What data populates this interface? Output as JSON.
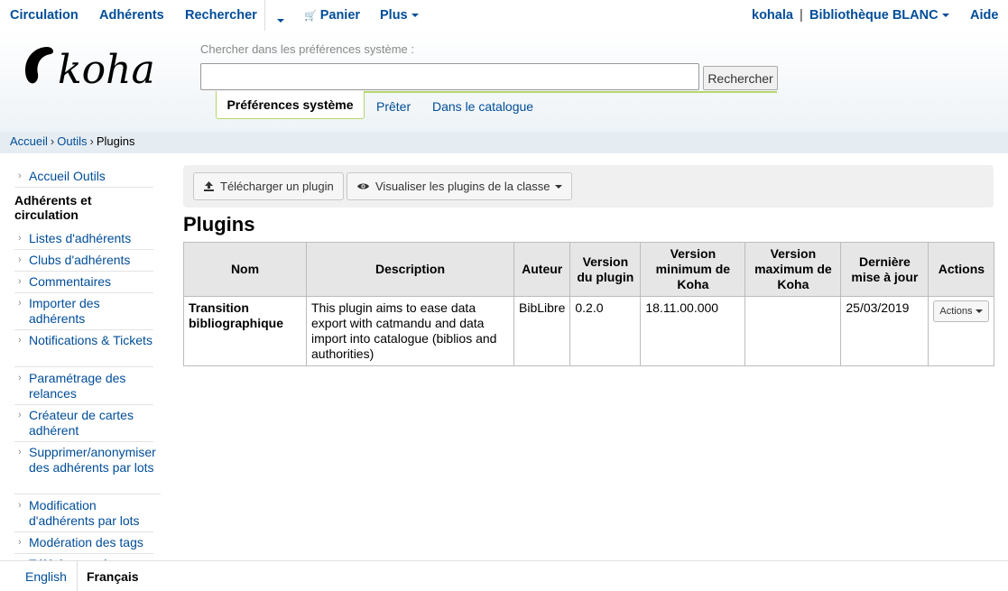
{
  "topnav": {
    "circulation": "Circulation",
    "patrons": "Adhérents",
    "search": "Rechercher",
    "cart": "Panier",
    "more": "Plus",
    "user": "kohala",
    "separator": "|",
    "library": "Bibliothèque BLANC",
    "help": "Aide"
  },
  "header": {
    "logo_text": "koha",
    "search_label": "Chercher dans les préférences système :",
    "search_value": "",
    "search_button": "Rechercher",
    "tabs": [
      {
        "label": "Préférences système",
        "active": true
      },
      {
        "label": "Prêter",
        "active": false
      },
      {
        "label": "Dans le catalogue",
        "active": false
      }
    ]
  },
  "breadcrumb": {
    "home": "Accueil",
    "tools": "Outils",
    "current": "Plugins",
    "separator": "›"
  },
  "sidebar": {
    "tools_home": "Accueil Outils",
    "section_heading": "Adhérents et circulation",
    "items": [
      "Listes d'adhérents",
      "Clubs d'adhérents",
      "Commentaires",
      "Importer des adhérents",
      "Notifications & Tickets",
      "Paramétrage des relances",
      "Créateur de cartes adhérent",
      "Supprimer/anonymiser des adhérents par lots",
      "Modification d'adhérents par lots",
      "Modération des tags",
      "Télécharger des..."
    ]
  },
  "toolbar": {
    "upload_label": "Télécharger un plugin",
    "view_class_label": "Visualiser les plugins de la classe"
  },
  "page": {
    "title": "Plugins"
  },
  "table": {
    "headers": [
      "Nom",
      "Description",
      "Auteur",
      "Version du plugin",
      "Version minimum de Koha",
      "Version maximum de Koha",
      "Dernière mise à jour",
      "Actions"
    ],
    "rows": [
      {
        "name": "Transition bibliographique",
        "description": "This plugin aims to ease data export with catmandu and data import into catalogue (biblios and authorities)",
        "author": "BibLibre",
        "plugin_version": "0.2.0",
        "min_koha": "18.11.00.000",
        "max_koha": "",
        "last_update": "25/03/2019",
        "actions_label": "Actions"
      }
    ]
  },
  "languages": {
    "english": "English",
    "french": "Français"
  },
  "colors": {
    "link": "#004d99",
    "accent_green": "#b7d66d",
    "breadcrumb_bg": "#e6edf2"
  }
}
